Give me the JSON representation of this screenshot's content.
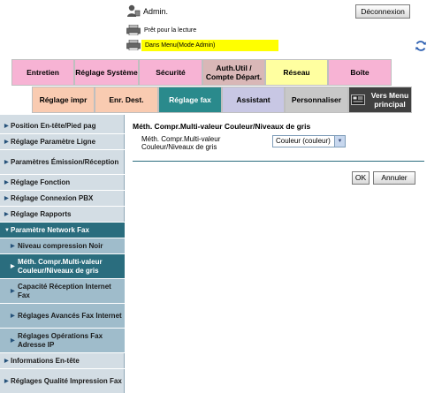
{
  "header": {
    "user_label": "Admin.",
    "logout_label": "Déconnexion",
    "status_text": "Prêt pour la lecture",
    "mode_text": "Dans Menu(Mode Admin)",
    "user_icon": "admin-user-icon",
    "status_icon": "printer-icon",
    "mode_icon": "printer-icon",
    "refresh_icon": "refresh-icon"
  },
  "tabs_row1": [
    {
      "label": "Entretien",
      "color": "#f7b3d4"
    },
    {
      "label": "Réglage Système",
      "color": "#f7b3d4"
    },
    {
      "label": "Sécurité",
      "color": "#f7b3d4"
    },
    {
      "label": "Auth.Util / Compte Départ.",
      "color": "#d9b7b7"
    },
    {
      "label": "Réseau",
      "color": "#ffffa0"
    },
    {
      "label": "Boîte",
      "color": "#f7b3d4"
    }
  ],
  "tabs_row2": [
    {
      "label": "Réglage impr",
      "color": "#f9cbb1"
    },
    {
      "label": "Enr. Dest.",
      "color": "#f9cbb1"
    },
    {
      "label": "Réglage fax",
      "color": "#2a8a8c",
      "active": true
    },
    {
      "label": "Assistant",
      "color": "#c8c7e4"
    },
    {
      "label": "Personnaliser",
      "color": "#c8c8c8"
    },
    {
      "label": "Vers Menu principal",
      "color": "#404040"
    }
  ],
  "sidebar": {
    "items": [
      {
        "label": "Position En-tête/Pied pag"
      },
      {
        "label": "Réglage Paramètre Ligne"
      },
      {
        "label": "Paramètres Émission/Réception"
      },
      {
        "label": "Réglage Fonction"
      },
      {
        "label": "Réglage Connexion PBX"
      },
      {
        "label": "Réglage Rapports"
      },
      {
        "label": "Paramètre Network Fax"
      },
      {
        "label": "Niveau compression Noir"
      },
      {
        "label": "Méth. Compr.Multi-valeur Couleur/Niveaux de gris"
      },
      {
        "label": "Capacité Réception Internet Fax"
      },
      {
        "label": "Réglages Avancés Fax Internet"
      },
      {
        "label": "Réglages Opérations Fax Adresse IP"
      },
      {
        "label": "Informations En-tête"
      },
      {
        "label": "Réglages Qualité Impression Fax"
      }
    ]
  },
  "main": {
    "title": "Méth. Compr.Multi-valeur Couleur/Niveaux de gris",
    "field_label": "Méth. Compr.Multi-valeur Couleur/Niveaux de gris",
    "select_value": "Couleur (couleur)",
    "ok_label": "OK",
    "cancel_label": "Annuler"
  }
}
